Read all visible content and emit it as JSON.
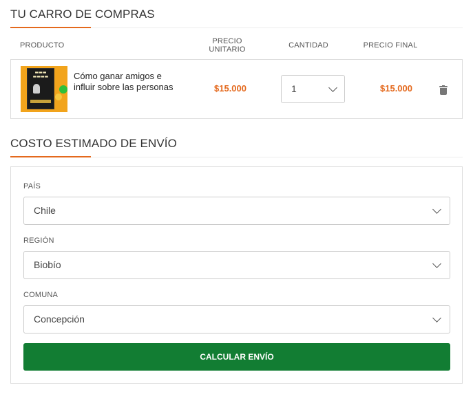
{
  "cart": {
    "title": "TU CARRO DE COMPRAS",
    "columns": {
      "product": "PRODUCTO",
      "unit_price_line1": "PRECIO",
      "unit_price_line2": "UNITARIO",
      "quantity": "CANTIDAD",
      "final_price": "PRECIO FINAL"
    },
    "items": [
      {
        "image_icon": "book-cover-image",
        "name": "Cómo ganar amigos e influir sobre las personas",
        "unit_price": "$15.000",
        "quantity": "1",
        "final_price": "$15.000",
        "remove_icon": "trash-icon"
      }
    ]
  },
  "shipping": {
    "title": "COSTO ESTIMADO DE ENVÍO",
    "country_label": "PAÍS",
    "country_value": "Chile",
    "region_label": "REGIÓN",
    "region_value": "Biobío",
    "commune_label": "COMUNA",
    "commune_value": "Concepción",
    "calculate_button": "CALCULAR ENVÍO"
  },
  "colors": {
    "accent": "#e4691d",
    "button": "#127d33",
    "price": "#e4691d"
  }
}
